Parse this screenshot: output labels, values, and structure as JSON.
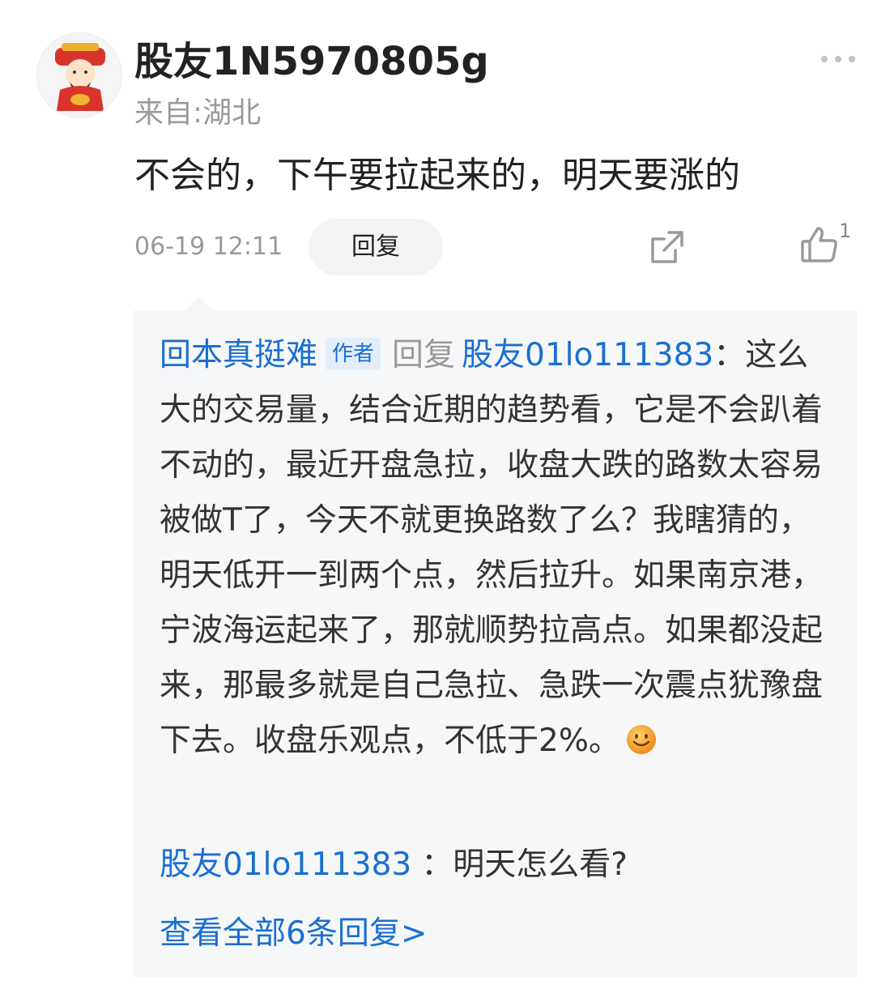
{
  "post": {
    "username": "股友1N5970805g",
    "location": "来自:湖北",
    "comment": "不会的，下午要拉起来的，明天要涨的",
    "timestamp": "06-19 12:11",
    "reply_label": "回复",
    "like_count": "1",
    "icons": {
      "avatar": "caishen-avatar",
      "more": "more-icon",
      "share": "share-icon",
      "like": "thumbs-up-icon"
    }
  },
  "replies": {
    "first": {
      "author": "回本真挺难",
      "badge": "作者",
      "reply_word": "回复",
      "target": "股友01lo111383",
      "separator": "：",
      "text": "这么大的交易量，结合近期的趋势看，它是不会趴着不动的，最近开盘急拉，收盘大跌的路数太容易被做T了，今天不就更换路数了么？我瞎猜的，明天低开一到两个点，然后拉升。如果南京港，宁波海运起来了，那就顺势拉高点。如果都没起来，那最多就是自己急拉、急跌一次震点犹豫盘下去。收盘乐观点，不低于2%。",
      "emoji": "smile-emoji"
    },
    "second": {
      "author": "股友01lo111383",
      "separator": "：",
      "text": "明天怎么看?"
    },
    "view_all": "查看全部6条回复>"
  },
  "colors": {
    "link_blue": "#1a6fd0",
    "reply_bg": "#f6f7f9",
    "button_bg": "#f2f3f5"
  }
}
